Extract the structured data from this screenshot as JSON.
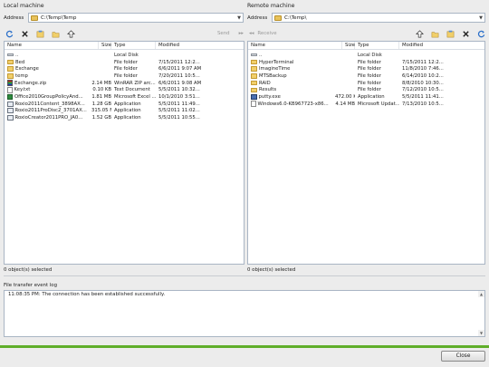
{
  "local": {
    "title": "Local machine",
    "address_label": "Address",
    "address_value": "C:\\Temp\\Temp",
    "toolbar": {
      "send_label": "Send"
    },
    "columns": [
      "Name",
      "Size",
      "Type",
      "Modified"
    ],
    "rows": [
      {
        "icon": "local-disk-icon",
        "name": "..",
        "size": "",
        "type": "Local Disk",
        "modified": ""
      },
      {
        "icon": "folder-icon",
        "name": "Bed",
        "size": "",
        "type": "File folder",
        "modified": "7/15/2011 12:2..."
      },
      {
        "icon": "folder-icon",
        "name": "Exchange",
        "size": "",
        "type": "File folder",
        "modified": "6/6/2011 9:07 AM"
      },
      {
        "icon": "folder-icon",
        "name": "temp",
        "size": "",
        "type": "File folder",
        "modified": "7/20/2011 10:5..."
      },
      {
        "icon": "zip-icon",
        "name": "Exchange.zip",
        "size": "2.14 MB",
        "type": "WinRAR ZIP arc...",
        "modified": "6/6/2011 9:08 AM"
      },
      {
        "icon": "text-file-icon",
        "name": "Key.txt",
        "size": "0.10 KB",
        "type": "Text Document",
        "modified": "5/5/2011 10:32..."
      },
      {
        "icon": "excel-icon",
        "name": "Office2010GroupPolicyAnd...",
        "size": "1.81 MB",
        "type": "Microsoft Excel ...",
        "modified": "10/1/2010 3:51..."
      },
      {
        "icon": "application-icon",
        "name": "Roxio2011Content_3898AX...",
        "size": "1.28 GB",
        "type": "Application",
        "modified": "5/5/2011 11:49..."
      },
      {
        "icon": "application-icon",
        "name": "Roxio2011ProDisc2_3701AX...",
        "size": "315.05 MB",
        "type": "Application",
        "modified": "5/5/2011 11:02..."
      },
      {
        "icon": "application-icon",
        "name": "RoxioCreator2011PRO_JA0...",
        "size": "1.52 GB",
        "type": "Application",
        "modified": "5/5/2011 10:55..."
      }
    ],
    "status": "0 object(s) selected"
  },
  "remote": {
    "title": "Remote machine",
    "address_label": "Address",
    "address_value": "C:\\Temp\\",
    "toolbar": {
      "receive_label": "Receive"
    },
    "columns": [
      "Name",
      "Size",
      "Type",
      "Modified"
    ],
    "rows": [
      {
        "icon": "local-disk-icon",
        "name": "..",
        "size": "",
        "type": "Local Disk",
        "modified": ""
      },
      {
        "icon": "folder-icon",
        "name": "HyperTerminal",
        "size": "",
        "type": "File folder",
        "modified": "7/15/2011 12:2..."
      },
      {
        "icon": "folder-icon",
        "name": "ImagineTime",
        "size": "",
        "type": "File folder",
        "modified": "11/8/2010 7:46..."
      },
      {
        "icon": "folder-icon",
        "name": "MTSBackup",
        "size": "",
        "type": "File folder",
        "modified": "6/14/2010 10:2..."
      },
      {
        "icon": "folder-icon",
        "name": "RAID",
        "size": "",
        "type": "File folder",
        "modified": "8/8/2010 10:30..."
      },
      {
        "icon": "folder-icon",
        "name": "Results",
        "size": "",
        "type": "File folder",
        "modified": "7/12/2010 10:5..."
      },
      {
        "icon": "putty-icon",
        "name": "putty.exe",
        "size": "472.00 KB",
        "type": "Application",
        "modified": "5/5/2011 11:41..."
      },
      {
        "icon": "update-package-icon",
        "name": "Windows6.0-KB967723-x86...",
        "size": "4.14 MB",
        "type": "Microsoft Updat...",
        "modified": "7/13/2010 10:5..."
      }
    ],
    "status": "0 object(s) selected"
  },
  "log": {
    "title": "File transfer event log",
    "lines": [
      "11:08:35 PM: The connection has been established successfully."
    ]
  },
  "footer": {
    "close_label": "Close"
  },
  "colors": {
    "progress": "#5fae2a",
    "folder": "#f1cf6a",
    "border": "#a9b5c4"
  }
}
